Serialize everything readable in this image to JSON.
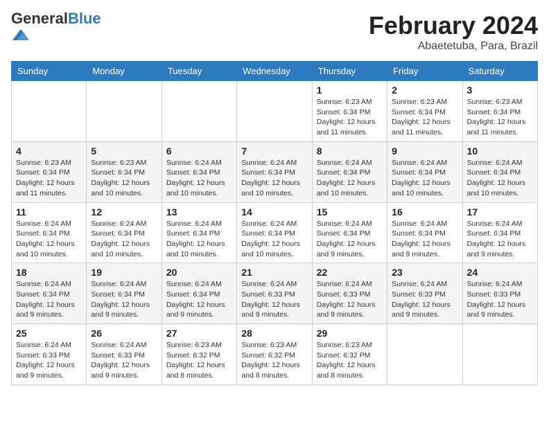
{
  "header": {
    "logo_general": "General",
    "logo_blue": "Blue",
    "month_title": "February 2024",
    "location": "Abaetetuba, Para, Brazil"
  },
  "days_of_week": [
    "Sunday",
    "Monday",
    "Tuesday",
    "Wednesday",
    "Thursday",
    "Friday",
    "Saturday"
  ],
  "weeks": [
    [
      {
        "day": "",
        "info": ""
      },
      {
        "day": "",
        "info": ""
      },
      {
        "day": "",
        "info": ""
      },
      {
        "day": "",
        "info": ""
      },
      {
        "day": "1",
        "info": "Sunrise: 6:23 AM\nSunset: 6:34 PM\nDaylight: 12 hours and 11 minutes."
      },
      {
        "day": "2",
        "info": "Sunrise: 6:23 AM\nSunset: 6:34 PM\nDaylight: 12 hours and 11 minutes."
      },
      {
        "day": "3",
        "info": "Sunrise: 6:23 AM\nSunset: 6:34 PM\nDaylight: 12 hours and 11 minutes."
      }
    ],
    [
      {
        "day": "4",
        "info": "Sunrise: 6:23 AM\nSunset: 6:34 PM\nDaylight: 12 hours and 11 minutes."
      },
      {
        "day": "5",
        "info": "Sunrise: 6:23 AM\nSunset: 6:34 PM\nDaylight: 12 hours and 10 minutes."
      },
      {
        "day": "6",
        "info": "Sunrise: 6:24 AM\nSunset: 6:34 PM\nDaylight: 12 hours and 10 minutes."
      },
      {
        "day": "7",
        "info": "Sunrise: 6:24 AM\nSunset: 6:34 PM\nDaylight: 12 hours and 10 minutes."
      },
      {
        "day": "8",
        "info": "Sunrise: 6:24 AM\nSunset: 6:34 PM\nDaylight: 12 hours and 10 minutes."
      },
      {
        "day": "9",
        "info": "Sunrise: 6:24 AM\nSunset: 6:34 PM\nDaylight: 12 hours and 10 minutes."
      },
      {
        "day": "10",
        "info": "Sunrise: 6:24 AM\nSunset: 6:34 PM\nDaylight: 12 hours and 10 minutes."
      }
    ],
    [
      {
        "day": "11",
        "info": "Sunrise: 6:24 AM\nSunset: 6:34 PM\nDaylight: 12 hours and 10 minutes."
      },
      {
        "day": "12",
        "info": "Sunrise: 6:24 AM\nSunset: 6:34 PM\nDaylight: 12 hours and 10 minutes."
      },
      {
        "day": "13",
        "info": "Sunrise: 6:24 AM\nSunset: 6:34 PM\nDaylight: 12 hours and 10 minutes."
      },
      {
        "day": "14",
        "info": "Sunrise: 6:24 AM\nSunset: 6:34 PM\nDaylight: 12 hours and 10 minutes."
      },
      {
        "day": "15",
        "info": "Sunrise: 6:24 AM\nSunset: 6:34 PM\nDaylight: 12 hours and 9 minutes."
      },
      {
        "day": "16",
        "info": "Sunrise: 6:24 AM\nSunset: 6:34 PM\nDaylight: 12 hours and 9 minutes."
      },
      {
        "day": "17",
        "info": "Sunrise: 6:24 AM\nSunset: 6:34 PM\nDaylight: 12 hours and 9 minutes."
      }
    ],
    [
      {
        "day": "18",
        "info": "Sunrise: 6:24 AM\nSunset: 6:34 PM\nDaylight: 12 hours and 9 minutes."
      },
      {
        "day": "19",
        "info": "Sunrise: 6:24 AM\nSunset: 6:34 PM\nDaylight: 12 hours and 9 minutes."
      },
      {
        "day": "20",
        "info": "Sunrise: 6:24 AM\nSunset: 6:34 PM\nDaylight: 12 hours and 9 minutes."
      },
      {
        "day": "21",
        "info": "Sunrise: 6:24 AM\nSunset: 6:33 PM\nDaylight: 12 hours and 9 minutes."
      },
      {
        "day": "22",
        "info": "Sunrise: 6:24 AM\nSunset: 6:33 PM\nDaylight: 12 hours and 9 minutes."
      },
      {
        "day": "23",
        "info": "Sunrise: 6:24 AM\nSunset: 6:33 PM\nDaylight: 12 hours and 9 minutes."
      },
      {
        "day": "24",
        "info": "Sunrise: 6:24 AM\nSunset: 6:33 PM\nDaylight: 12 hours and 9 minutes."
      }
    ],
    [
      {
        "day": "25",
        "info": "Sunrise: 6:24 AM\nSunset: 6:33 PM\nDaylight: 12 hours and 9 minutes."
      },
      {
        "day": "26",
        "info": "Sunrise: 6:24 AM\nSunset: 6:33 PM\nDaylight: 12 hours and 9 minutes."
      },
      {
        "day": "27",
        "info": "Sunrise: 6:23 AM\nSunset: 6:32 PM\nDaylight: 12 hours and 8 minutes."
      },
      {
        "day": "28",
        "info": "Sunrise: 6:23 AM\nSunset: 6:32 PM\nDaylight: 12 hours and 8 minutes."
      },
      {
        "day": "29",
        "info": "Sunrise: 6:23 AM\nSunset: 6:32 PM\nDaylight: 12 hours and 8 minutes."
      },
      {
        "day": "",
        "info": ""
      },
      {
        "day": "",
        "info": ""
      }
    ]
  ]
}
